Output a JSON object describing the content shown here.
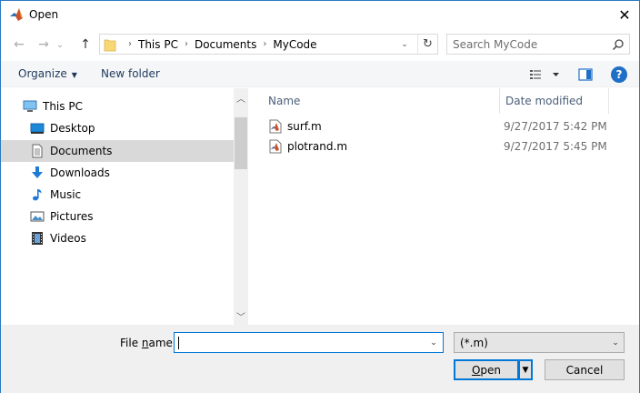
{
  "window": {
    "title": "Open",
    "close_symbol": "✕"
  },
  "nav": {
    "back_symbol": "←",
    "forward_symbol": "→",
    "dropdown_symbol": "⌄",
    "up_symbol": "↑"
  },
  "address": {
    "crumbs": [
      "This PC",
      "Documents",
      "MyCode"
    ],
    "separator": "›",
    "refresh_symbol": "↻"
  },
  "search": {
    "placeholder": "Search MyCode"
  },
  "toolbar": {
    "organize_label": "Organize",
    "new_folder_label": "New folder",
    "help_symbol": "?"
  },
  "sidebar": {
    "items": [
      {
        "label": "This PC",
        "icon": "this-pc-icon"
      },
      {
        "label": "Desktop",
        "icon": "desktop-icon"
      },
      {
        "label": "Documents",
        "icon": "documents-icon",
        "selected": true
      },
      {
        "label": "Downloads",
        "icon": "downloads-icon"
      },
      {
        "label": "Music",
        "icon": "music-icon"
      },
      {
        "label": "Pictures",
        "icon": "pictures-icon"
      },
      {
        "label": "Videos",
        "icon": "videos-icon"
      }
    ]
  },
  "files": {
    "columns": {
      "name": "Name",
      "date": "Date modified"
    },
    "rows": [
      {
        "name": "surf.m",
        "date": "9/27/2017 5:42 PM",
        "icon": "matlab-file-icon"
      },
      {
        "name": "plotrand.m",
        "date": "9/27/2017 5:45 PM",
        "icon": "matlab-file-icon"
      }
    ]
  },
  "bottom": {
    "file_name_label_prefix": "File ",
    "file_name_label_accel": "n",
    "file_name_label_suffix": "ame:",
    "file_name_value": "",
    "filter_value": "(*.m)",
    "open_label_accel": "O",
    "open_label_rest": "pen",
    "cancel_label": "Cancel"
  },
  "colors": {
    "accent": "#0078d7",
    "selection": "#d9d9d9",
    "help": "#1f6fc6"
  }
}
